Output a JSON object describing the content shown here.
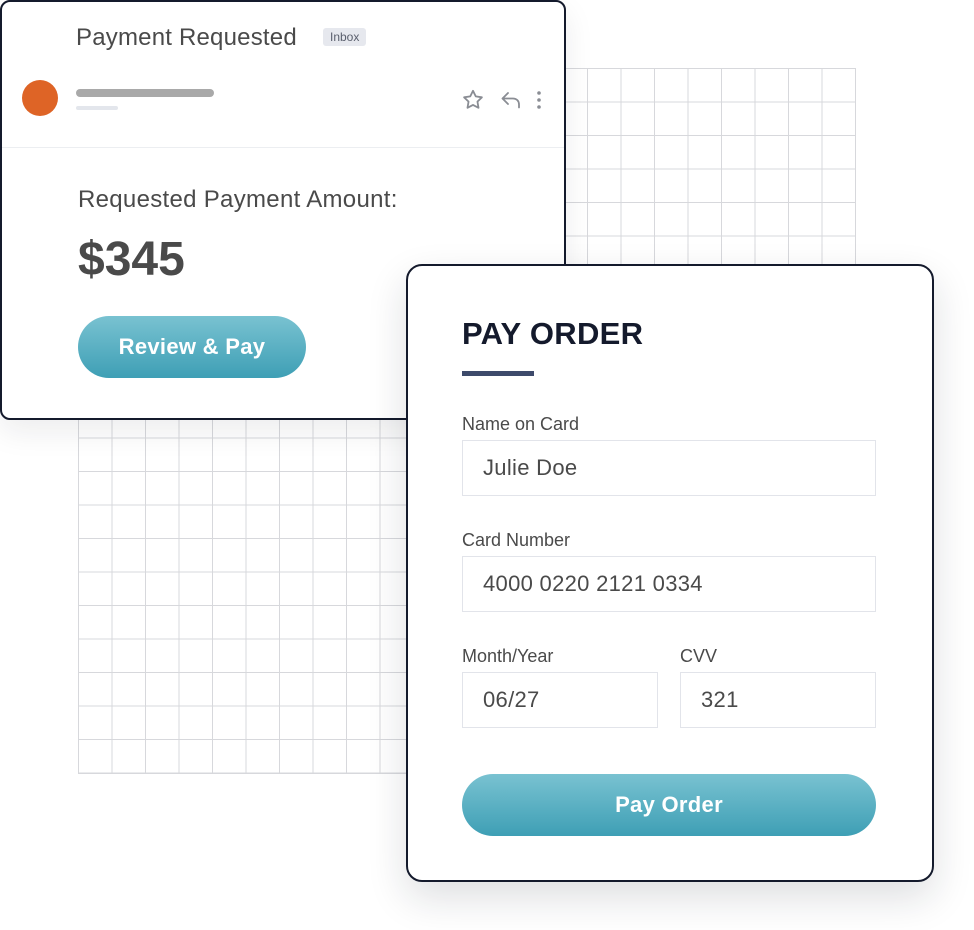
{
  "email": {
    "subject": "Payment Requested",
    "badge": "Inbox",
    "amount_label": "Requested Payment Amount:",
    "amount": "$345",
    "review_button": "Review & Pay",
    "icons": [
      "star-icon",
      "reply-icon",
      "more-vertical-icon"
    ],
    "avatar_color": "#de6426"
  },
  "pay_order": {
    "title": "PAY ORDER",
    "name_label": "Name on Card",
    "name_value": "Julie Doe",
    "card_label": "Card Number",
    "card_value": "4000 0220 2121 0334",
    "expiry_label": "Month/Year",
    "expiry_value": "06/27",
    "cvv_label": "CVV",
    "cvv_value": "321",
    "pay_button": "Pay Order"
  },
  "colors": {
    "accent_button": "#4aa8bd",
    "border_dark": "#141a2c",
    "underline": "#3d4a6b"
  }
}
